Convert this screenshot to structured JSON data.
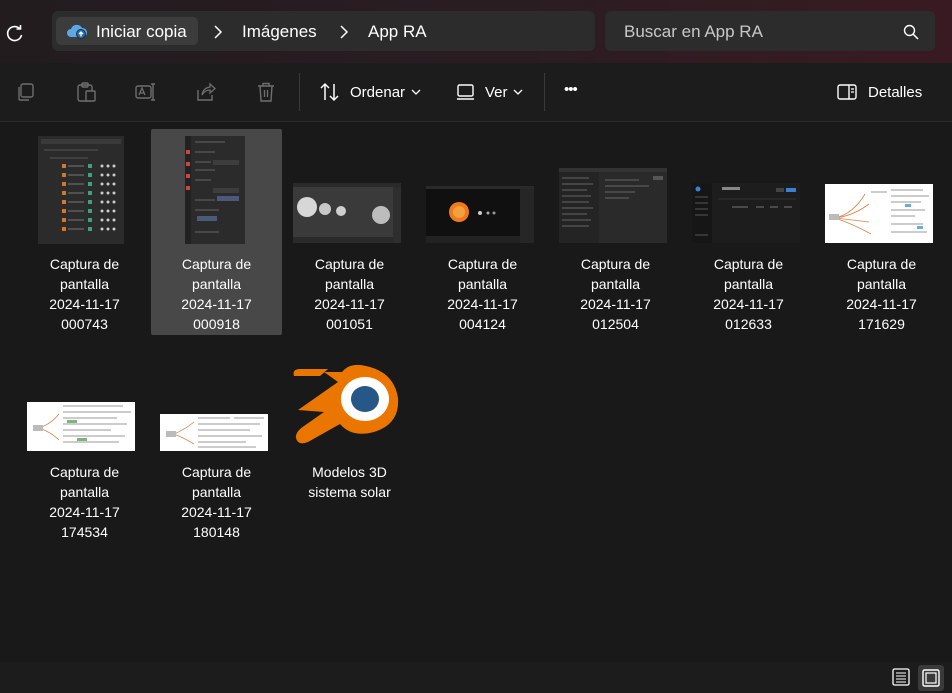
{
  "address": {
    "crumbs": [
      "Iniciar copia",
      "Imágenes",
      "App RA"
    ],
    "search_placeholder": "Buscar en App RA"
  },
  "toolbar": {
    "sort_label": "Ordenar",
    "view_label": "Ver",
    "more_label": "•••",
    "details_label": "Detalles"
  },
  "items": [
    {
      "l1": "Captura de",
      "l2": "pantalla",
      "l3": "2024-11-17",
      "l4": "000743"
    },
    {
      "l1": "Captura de",
      "l2": "pantalla",
      "l3": "2024-11-17",
      "l4": "000918"
    },
    {
      "l1": "Captura de",
      "l2": "pantalla",
      "l3": "2024-11-17",
      "l4": "001051"
    },
    {
      "l1": "Captura de",
      "l2": "pantalla",
      "l3": "2024-11-17",
      "l4": "004124"
    },
    {
      "l1": "Captura de",
      "l2": "pantalla",
      "l3": "2024-11-17",
      "l4": "012504"
    },
    {
      "l1": "Captura de",
      "l2": "pantalla",
      "l3": "2024-11-17",
      "l4": "012633"
    },
    {
      "l1": "Captura de",
      "l2": "pantalla",
      "l3": "2024-11-17",
      "l4": "171629"
    },
    {
      "l1": "Captura de",
      "l2": "pantalla",
      "l3": "2024-11-17",
      "l4": "174534"
    },
    {
      "l1": "Captura de",
      "l2": "pantalla",
      "l3": "2024-11-17",
      "l4": "180148"
    },
    {
      "l1": "Modelos 3D",
      "l2": "sistema solar"
    }
  ],
  "colors": {
    "accent_orange": "#ea7600",
    "blender_blue": "#265787",
    "selected_tile": "#484848"
  }
}
